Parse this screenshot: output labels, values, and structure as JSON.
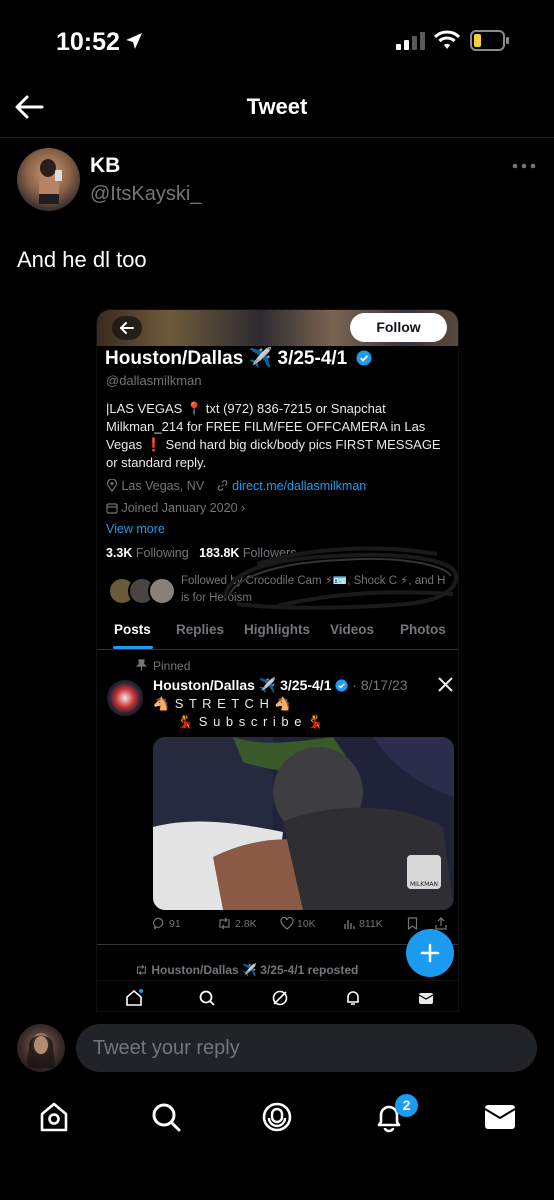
{
  "status_bar": {
    "time": "10:52"
  },
  "header": {
    "title": "Tweet"
  },
  "tweet": {
    "display_name": "KB",
    "handle": "@ItsKayski_",
    "text": "And he dl too"
  },
  "screenshot": {
    "follow_label": "Follow",
    "profile_name": "Houston/Dallas ✈️ 3/25-4/1",
    "profile_handle": "@dallasmilkman",
    "bio": "|LAS VEGAS 📍 txt (972) 836-7215 or Snapchat Milkman_214 for FREE FILM/FEE OFFCAMERA in Las Vegas ❗ Send hard big dick/body pics FIRST MESSAGE or standard reply.",
    "location": "Las Vegas, NV",
    "website": "direct.me/dallasmilkman",
    "joined": "Joined January 2020",
    "view_more": "View more",
    "following_count": "3.3K",
    "following_label": "Following",
    "followers_count": "183.8K",
    "followers_label": "Followers",
    "followed_by": "Followed by Crocodile Cam ⚡🪪, Shock C ⚡, and H is for Heroism",
    "tabs": [
      "Posts",
      "Replies",
      "Highlights",
      "Videos",
      "Photos"
    ],
    "pinned_label": "Pinned",
    "post_author": "Houston/Dallas ✈️ 3/25-4/1",
    "post_date": "· 8/17/23",
    "post_line1": "🐴 S T R E T C H 🐴",
    "post_line2": "💃 S u b s c r i b e 💃",
    "media_watermark": "MILKMAN",
    "actions": {
      "replies": "91",
      "reposts": "2.8K",
      "likes": "10K",
      "views": "811K"
    },
    "repost_label": "Houston/Dallas ✈️ 3/25-4/1 reposted",
    "accent": "#1d9bf0"
  },
  "reply": {
    "placeholder": "Tweet your reply"
  },
  "bottom_nav": {
    "notification_count": "2"
  }
}
